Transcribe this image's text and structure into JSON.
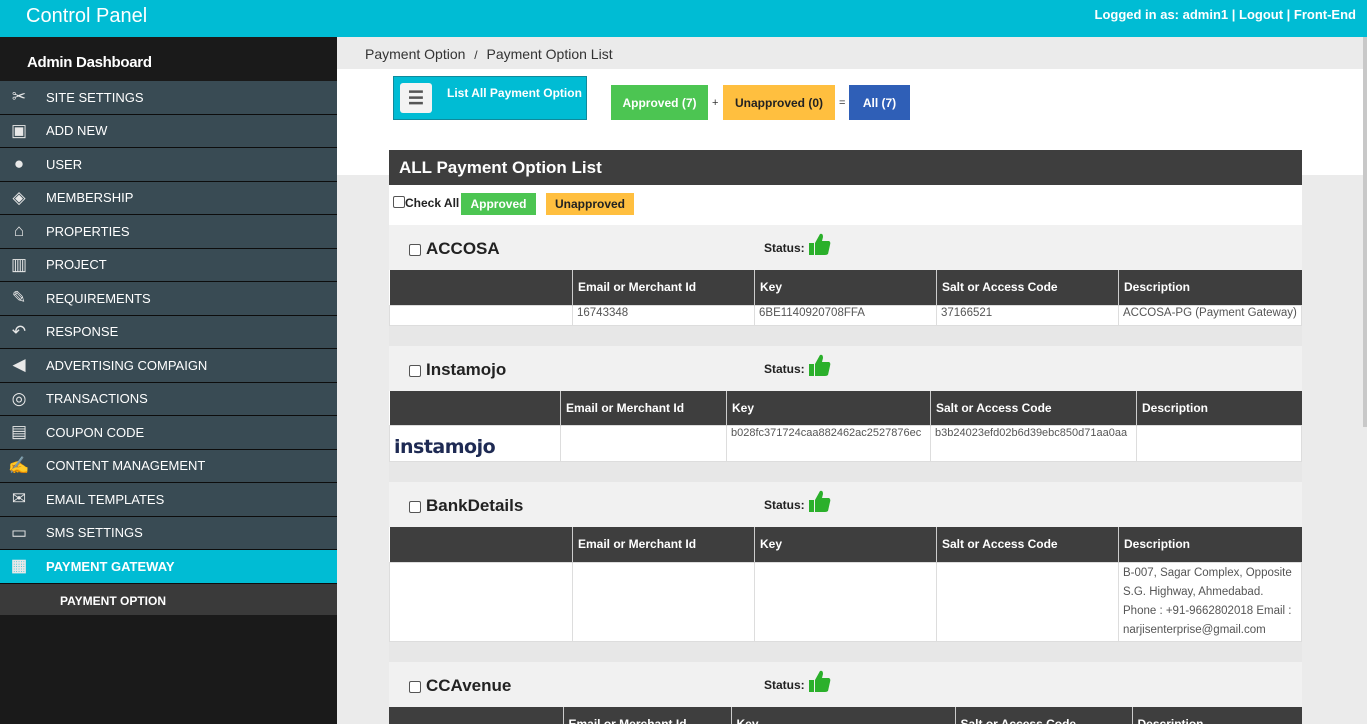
{
  "topbar": {
    "title": "Control Panel",
    "user_links": "Logged in as: admin1 | Logout | Front-End"
  },
  "sidebar": {
    "heading": "Admin Dashboard",
    "items": [
      {
        "label": "SITE SETTINGS"
      },
      {
        "label": "ADD NEW"
      },
      {
        "label": "USER"
      },
      {
        "label": "MEMBERSHIP"
      },
      {
        "label": "PROPERTIES"
      },
      {
        "label": "PROJECT"
      },
      {
        "label": "REQUIREMENTS"
      },
      {
        "label": "RESPONSE"
      },
      {
        "label": "ADVERTISING COMPAIGN"
      },
      {
        "label": "TRANSACTIONS"
      },
      {
        "label": "COUPON CODE"
      },
      {
        "label": "CONTENT MANAGEMENT"
      },
      {
        "label": "EMAIL TEMPLATES"
      },
      {
        "label": "SMS SETTINGS"
      },
      {
        "label": "PAYMENT GATEWAY"
      }
    ],
    "sub_item": "PAYMENT OPTION"
  },
  "breadcrumb": {
    "parent": "Payment Option",
    "sep": "/",
    "current": "Payment Option List"
  },
  "actions": {
    "list_all": "List All Payment Option",
    "approved": "Approved (7)",
    "plus": "+",
    "unapproved": "Unapproved (0)",
    "equals": "=",
    "all": "All (7)"
  },
  "colors": {
    "accent": "#00bcd4",
    "approved": "#4cc552",
    "unapproved": "#ffbf3f",
    "all": "#2f5fb7",
    "thumb": "#2bb02b"
  },
  "panel": {
    "title": "ALL Payment Option List",
    "check_all": "Check All",
    "approved": "Approved",
    "unapproved": "Unapproved"
  },
  "columns": {
    "c1": "Email or Merchant Id",
    "c2": "Key",
    "c3": "Salt or Access Code",
    "c4": "Description"
  },
  "status_label": "Status:",
  "options": [
    {
      "name": "ACCOSA",
      "logo": "",
      "merchant": "16743348",
      "key": "6BE1140920708FFA",
      "salt": "37166521",
      "desc": "ACCOSA-PG (Payment Gateway)"
    },
    {
      "name": "Instamojo",
      "logo": "instamojo",
      "merchant": "",
      "key": "b028fc371724caa882462ac2527876ec",
      "salt": "b3b24023efd02b6d39ebc850d71aa0aa",
      "desc": ""
    },
    {
      "name": "BankDetails",
      "logo": "",
      "merchant": "",
      "key": "",
      "salt": "",
      "desc": "B-007, Sagar Complex, Opposite S.G. Highway, Ahmedabad. Phone : +91-9662802018 Email : narjisenterprise@gmail.com"
    },
    {
      "name": "CCAvenue"
    }
  ]
}
